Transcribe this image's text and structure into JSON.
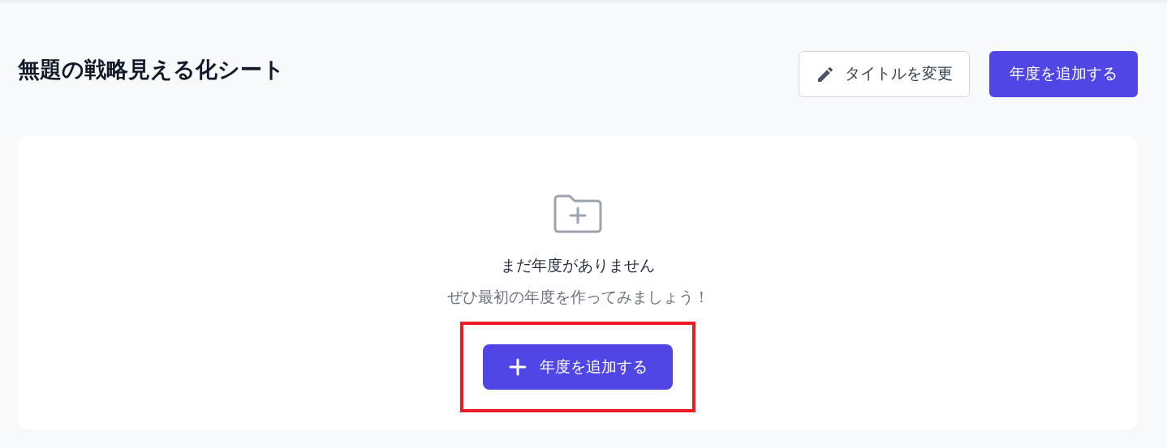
{
  "header": {
    "title": "無題の戦略見える化シート",
    "buttons": [
      {
        "label": "タイトルを変更",
        "kind": "outline"
      },
      {
        "label": "年度を追加する",
        "kind": "primary"
      }
    ]
  },
  "empty_state": {
    "message": "まだ年度がありません",
    "hint": "ぜひ最初の年度を作ってみましょう！",
    "button": {
      "label": "年度を追加する",
      "highlighted": true
    }
  }
}
